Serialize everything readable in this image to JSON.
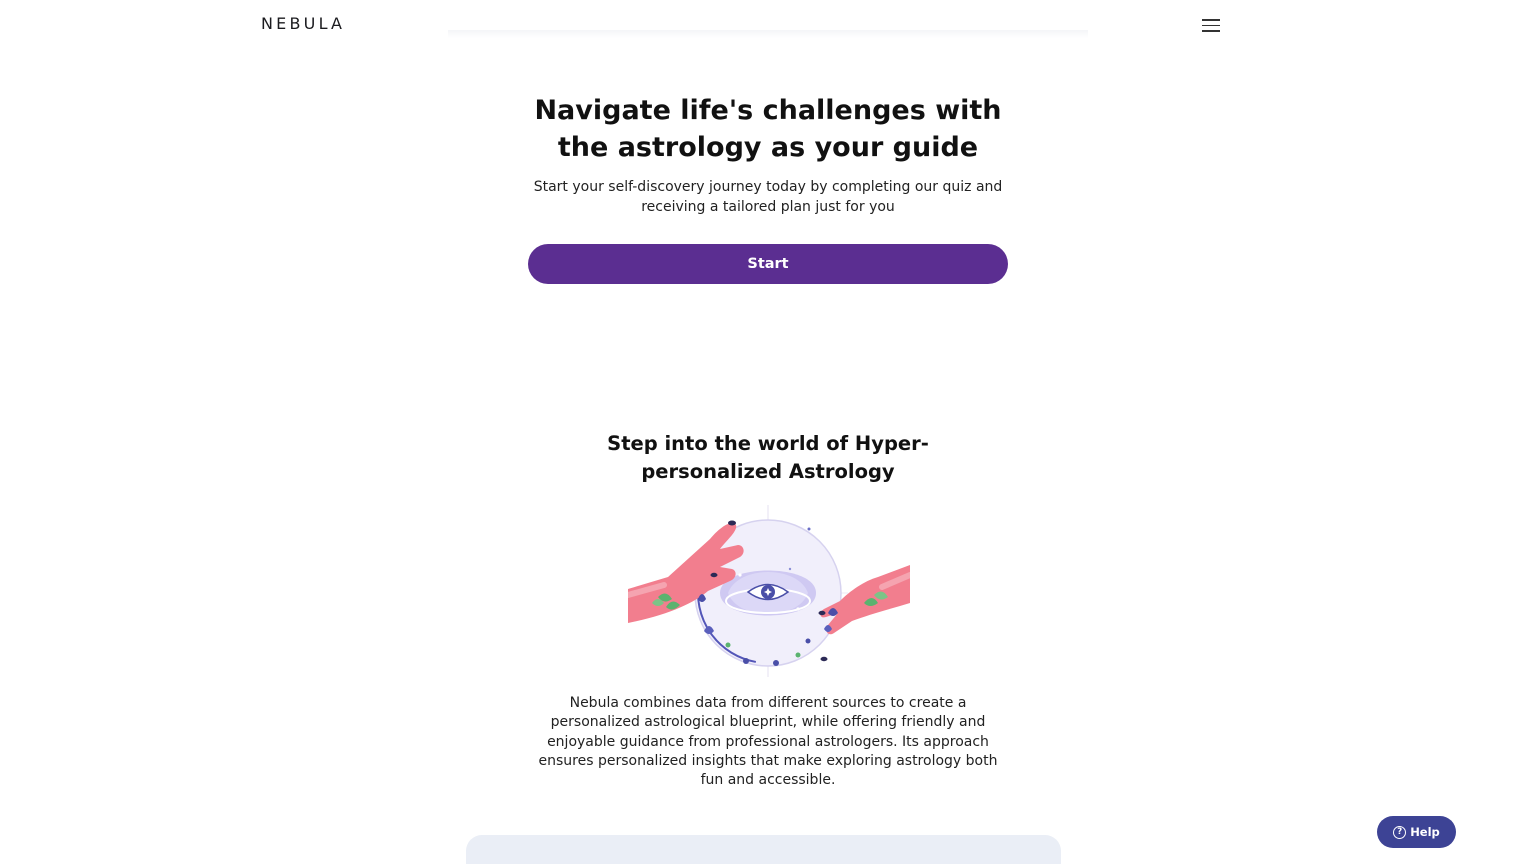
{
  "header": {
    "logo_text": "NEBULA",
    "menu_icon": "hamburger-menu-icon"
  },
  "hero": {
    "title": "Navigate life's challenges with the astrology as your guide",
    "subtitle": "Start your self-discovery journey today by completing our quiz and receiving a tailored plan just for you",
    "start_label": "Start"
  },
  "section2": {
    "title": "Step into the world of Hyper-personalized Astrology",
    "illustration": "hands-crystal-ball-eye-illustration",
    "body": "Nebula combines data from different sources to create a personalized astrological blueprint, while offering friendly and enjoyable guidance from professional astrologers. Its approach ensures personalized insights that make exploring astrology both fun and accessible."
  },
  "help": {
    "label": "Help",
    "icon": "question-circle-icon"
  },
  "colors": {
    "primary": "#5b2e91",
    "help_button": "#3d4395",
    "card_bg": "#eaeef6"
  }
}
